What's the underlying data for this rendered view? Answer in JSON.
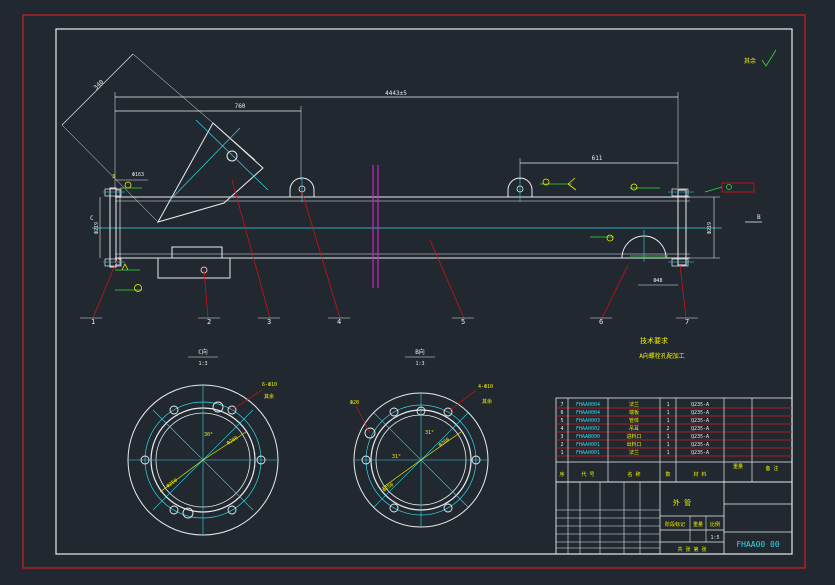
{
  "colors": {
    "background": "#212830",
    "frame": "#d01f1f",
    "white": "#e8ecef",
    "cyan": "#33d6e6",
    "green": "#2fe02f",
    "yellow": "#f0f000",
    "magenta": "#d020d0",
    "red": "#e01010"
  },
  "dims": {
    "overall": "4443±5",
    "left_offset": "760",
    "right_offset": "611",
    "diag": "340",
    "left_small": "Ф163",
    "left_vert": "Ф219",
    "right_vert": "Ф219",
    "bottom_right": "Ф48",
    "left_marker": "C",
    "right_marker": "B"
  },
  "weld": {
    "symbol_label": "3",
    "surface_note": "其余"
  },
  "balloons": [
    "1",
    "2",
    "3",
    "4",
    "5",
    "6",
    "7"
  ],
  "notes": {
    "title": "技术要求",
    "line1": "A向螺栓孔配加工"
  },
  "views": {
    "c": {
      "title": "C向",
      "scale": "1:3",
      "holes": "6-Ф10",
      "pcd": "Ф250",
      "bore": "Ф200",
      "angle": "30°"
    },
    "b": {
      "title": "B向",
      "scale": "1:3",
      "holes": "4-Ф10",
      "pcd": "Ф250",
      "bore": "Ф200",
      "angle": "31°",
      "tag": "Ф20"
    }
  },
  "parts": [
    {
      "no": "7",
      "code": "FHAA0004",
      "name": "法兰",
      "qty": "1",
      "material": "Q235-A"
    },
    {
      "no": "6",
      "code": "FHAA0004",
      "name": "端板",
      "qty": "1",
      "material": "Q235-A"
    },
    {
      "no": "5",
      "code": "FHAA0003",
      "name": "管体",
      "qty": "1",
      "material": "Q235-A"
    },
    {
      "no": "4",
      "code": "FHAA0002",
      "name": "吊耳",
      "qty": "2",
      "material": "Q235-A"
    },
    {
      "no": "3",
      "code": "FHAAB000",
      "name": "进料口",
      "qty": "1",
      "material": "Q235-A"
    },
    {
      "no": "2",
      "code": "FHAA0001",
      "name": "出料口",
      "qty": "1",
      "material": "Q235-A"
    },
    {
      "no": "1",
      "code": "FHAA0001",
      "name": "法兰",
      "qty": "1",
      "material": "Q235-A"
    }
  ],
  "bom_header": {
    "no": "序",
    "code": "代  号",
    "name": "名  称",
    "qty": "数",
    "material": "材  料",
    "weight": "重量",
    "note": "备  注"
  },
  "title_block": {
    "part_name": "外  管",
    "drawing_no": "FHAA00 00",
    "scale": "1:5",
    "stage": "阶段标记",
    "weight": "重量",
    "ratio": "比例",
    "sheet": "共  张  第  张"
  }
}
